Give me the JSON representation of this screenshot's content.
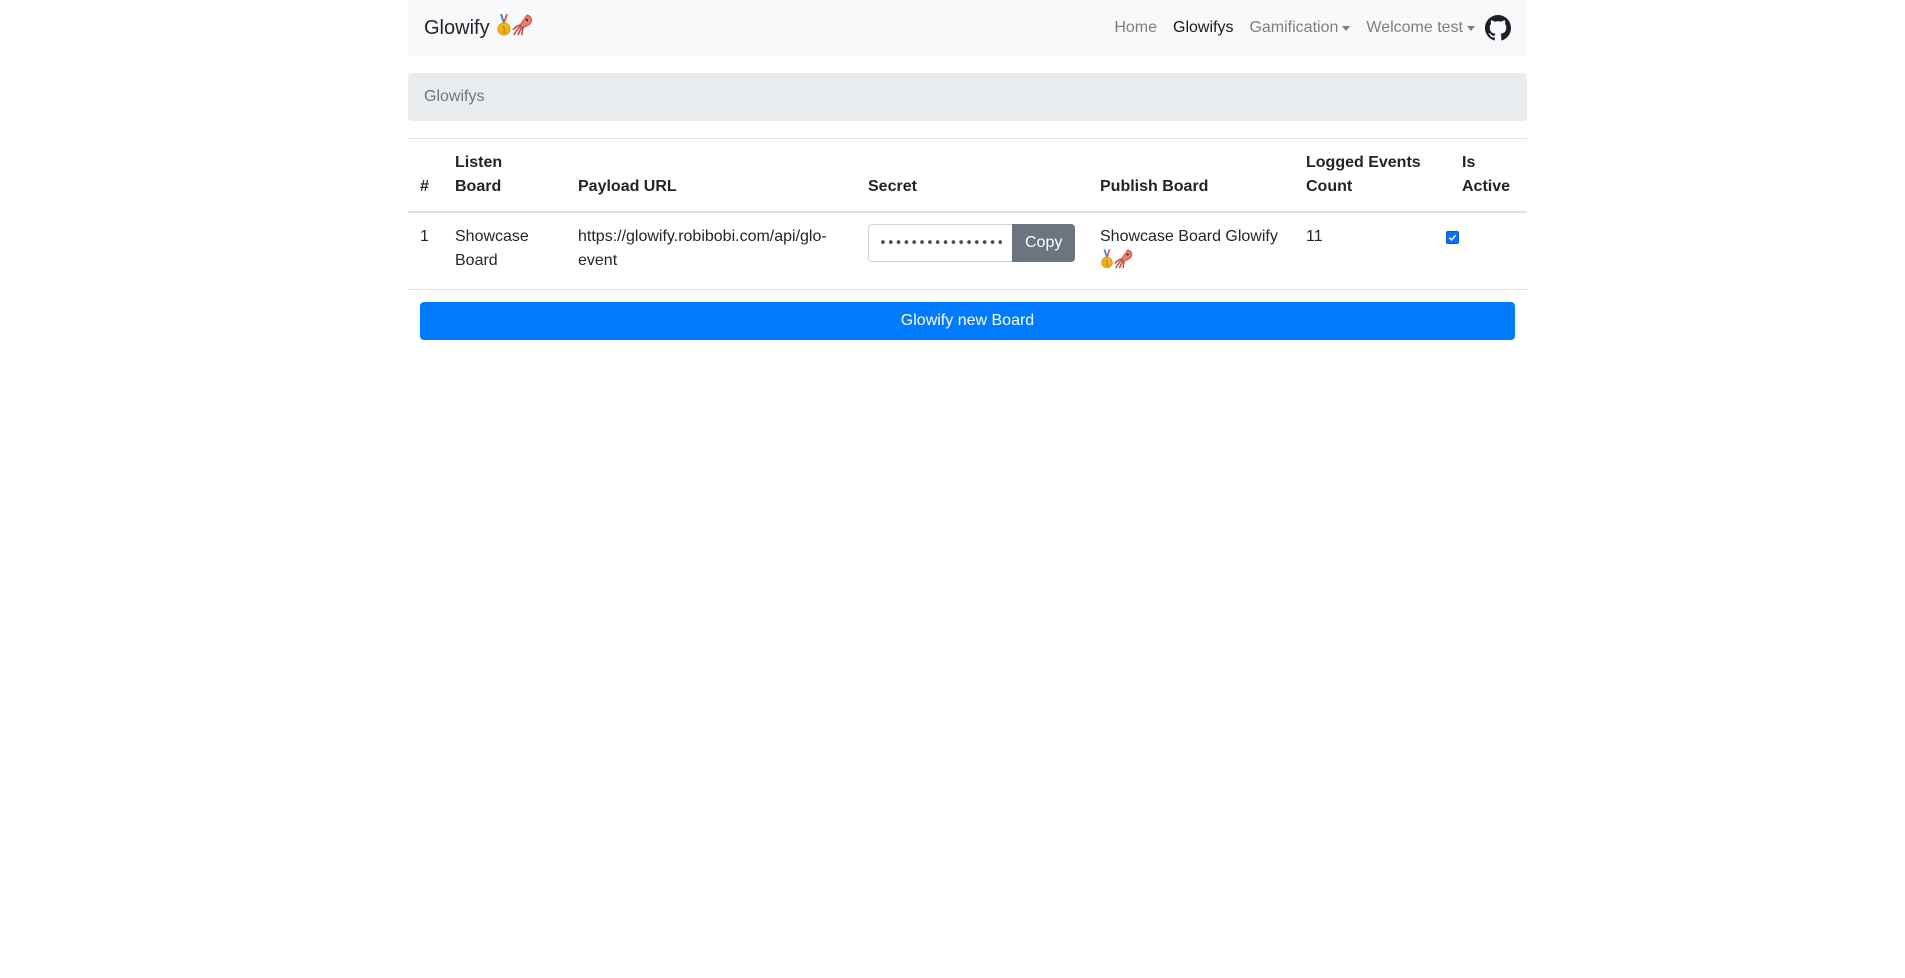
{
  "navbar": {
    "brand": "Glowify",
    "links": {
      "home": "Home",
      "glowifys": "Glowifys",
      "gamification": "Gamification",
      "welcome": "Welcome test"
    }
  },
  "breadcrumb": {
    "current": "Glowifys"
  },
  "table": {
    "headers": {
      "num": "#",
      "listen_board_line1": "Listen",
      "listen_board_line2": "Board",
      "payload_url": "Payload URL",
      "secret": "Secret",
      "publish_board": "Publish Board",
      "logged_line1": "Logged Events",
      "logged_line2": "Count",
      "active_line1": "Is",
      "active_line2": "Active"
    },
    "rows": [
      {
        "num": "1",
        "listen_board_line1": "Showcase",
        "listen_board_line2": "Board",
        "payload_url_line1": "https://glowify.robibobi.com/api/glo-",
        "payload_url_line2": "event",
        "secret_masked": "••••••••••••••••",
        "copy_label": "Copy",
        "publish_board": "Showcase Board Glowify",
        "logged_events_count": "11",
        "is_active": true
      }
    ]
  },
  "actions": {
    "new_board_label": "Glowify new Board"
  },
  "colors": {
    "primary": "#007bff",
    "secondary": "#6c757d",
    "navbar_bg": "#f8f9fa",
    "breadcrumb_bg": "#e9ecef"
  },
  "icons": {
    "brand_emojis": [
      "medal-icon",
      "squid-icon"
    ],
    "github": "github-icon"
  }
}
